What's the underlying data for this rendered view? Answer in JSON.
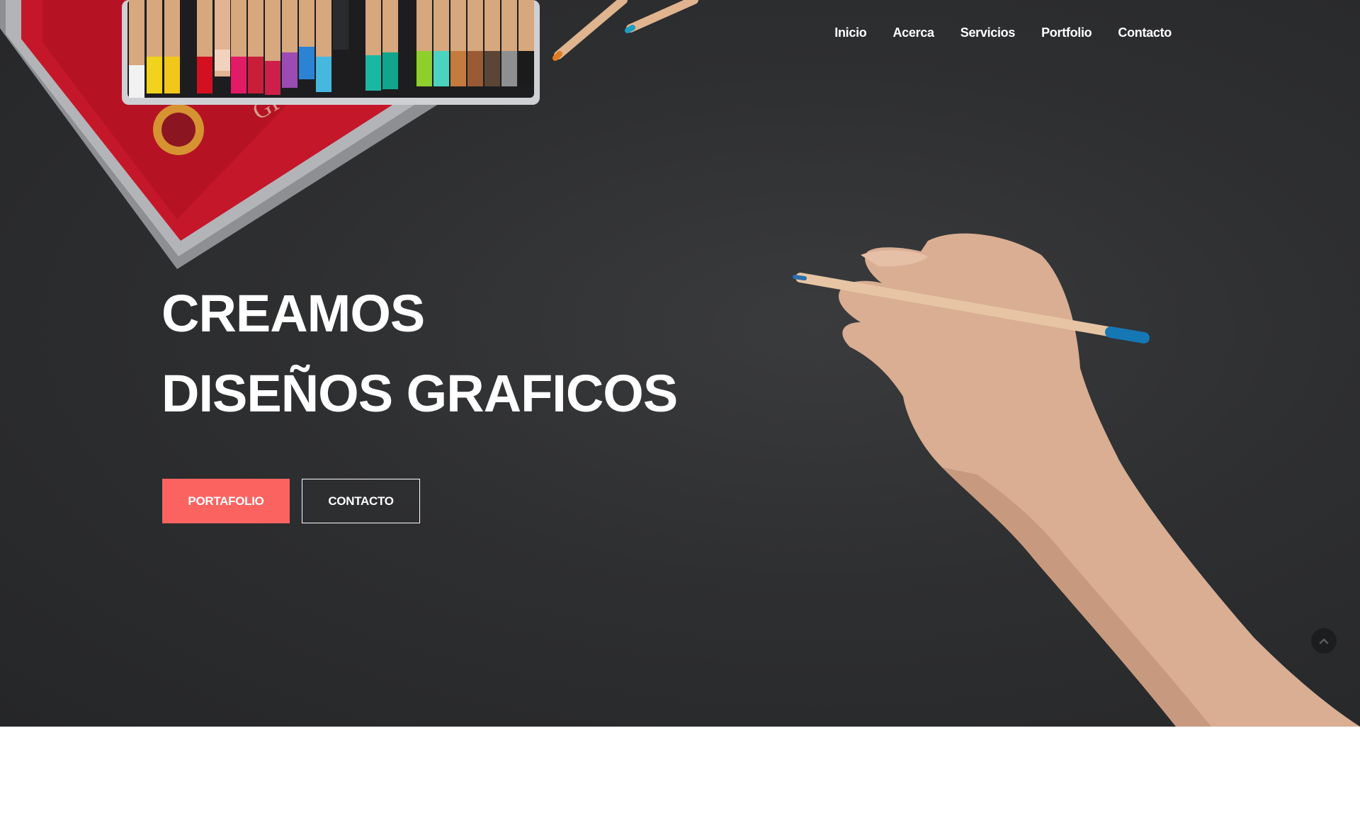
{
  "nav": {
    "items": [
      {
        "label": "Inicio"
      },
      {
        "label": "Acerca"
      },
      {
        "label": "Servicios"
      },
      {
        "label": "Portfolio"
      },
      {
        "label": "Contacto"
      }
    ]
  },
  "hero": {
    "headline_line1": "CREAMOS",
    "headline_line2": "DISEÑOS GRAFICOS",
    "primary_button": "PORTAFOLIO",
    "secondary_button": "CONTACTO"
  },
  "colors": {
    "accent": "#fb6360",
    "hero_background": "#2e2f31",
    "text": "#ffffff",
    "page_background": "#ffffff"
  },
  "icons": {
    "scroll_top": "chevron-up-icon"
  }
}
